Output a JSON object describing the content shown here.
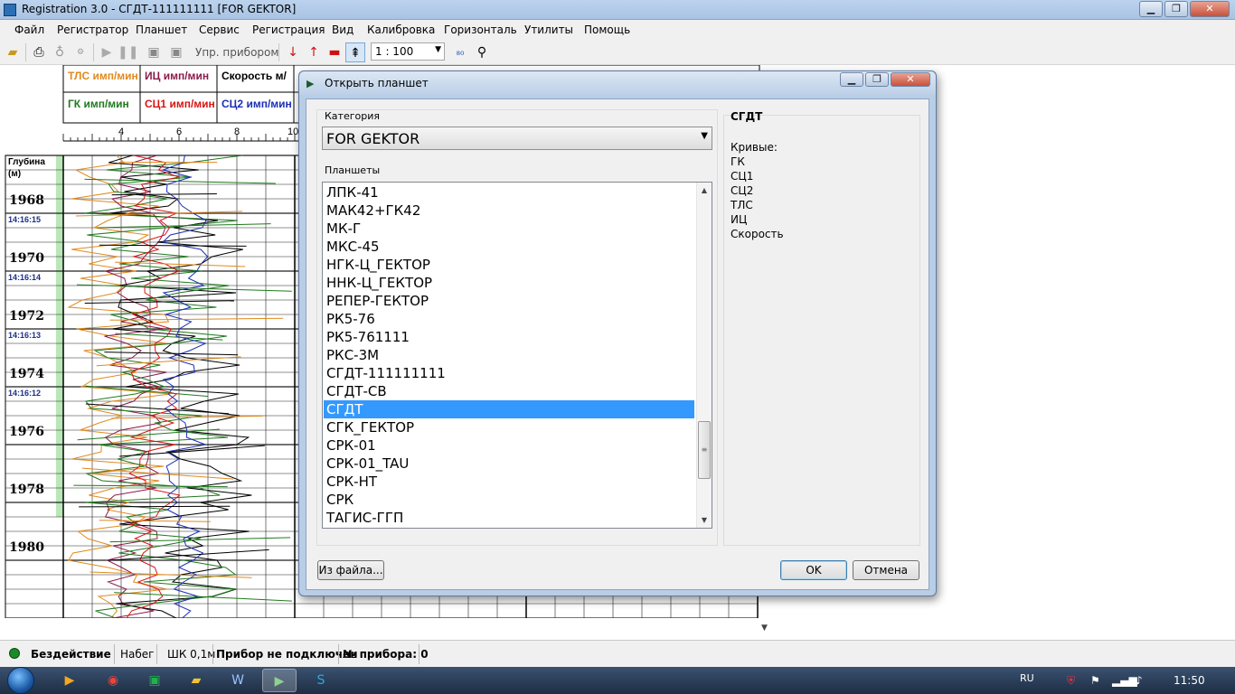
{
  "window": {
    "title": "Registration 3.0 - СГДТ-111111111 [FOR GEKTOR]"
  },
  "menu": [
    "Файл",
    "Регистратор",
    "Планшет",
    "Сервис",
    "Регистрация",
    "Вид",
    "Калибровка",
    "Горизонталь",
    "Утилиты",
    "Помощь"
  ],
  "toolbar": {
    "instrument_label": "Упр. прибором",
    "scale": "1 : 100"
  },
  "plot": {
    "headers": {
      "row1": [
        "ТЛС имп/мин",
        "ИЦ имп/мин",
        "Скорость м/"
      ],
      "row2": [
        "ГК имп/мин",
        "СЦ1 имп/мин",
        "СЦ2 имп/мин"
      ]
    },
    "header_colors": {
      "ТЛС": "#e08a1e",
      "ИЦ": "#8b1a4a",
      "Скорость": "#000000",
      "ГК": "#1f7a1f",
      "СЦ1": "#d81414",
      "СЦ2": "#1b2fb5"
    },
    "axis_ticks": [
      "4",
      "6",
      "8",
      "10"
    ],
    "depth_title": "Глубина (м)",
    "depths": [
      "1968",
      "1970",
      "1972",
      "1974",
      "1976",
      "1978",
      "1980"
    ],
    "times": [
      "14:16:15",
      "14:16:14",
      "14:16:13",
      "14:16:12"
    ]
  },
  "dialog": {
    "title": "Открыть планшет",
    "category_label": "Категория",
    "category_value": "FOR GEKTOR",
    "list_label": "Планшеты",
    "items": [
      "ЛПК-41",
      "МАК42+ГК42",
      "МК-Г",
      "МКС-45",
      "НГК-Ц_ГЕКТОР",
      "ННК-Ц_ГЕКТОР",
      "РЕПЕР-ГЕКТОР",
      "РК5-76",
      "РК5-761111",
      "РКС-3М",
      "СГДТ-111111111",
      "СГДТ-СВ",
      "СГДТ",
      "СГК_ГЕКТОР",
      "СРК-01",
      "СРК-01_TAU",
      "СРК-НТ",
      "СРК",
      "ТАГИС-ГГП"
    ],
    "selected": "СГДТ",
    "info_title": "СГДТ",
    "curves_label": "Кривые:",
    "curves": [
      "ГК",
      "СЦ1",
      "СЦ2",
      "ТЛС",
      "ИЦ",
      "Скорость"
    ],
    "from_file_label": "Из файла...",
    "ok_label": "OK",
    "cancel_label": "Отмена"
  },
  "status": {
    "state": "Бездействие",
    "mode": "Набег",
    "step": "ШК 0,1м",
    "device": "Прибор не подключен",
    "device_no": "№ прибора: 0"
  },
  "taskbar": {
    "lang": "RU",
    "clock": "11:50"
  }
}
